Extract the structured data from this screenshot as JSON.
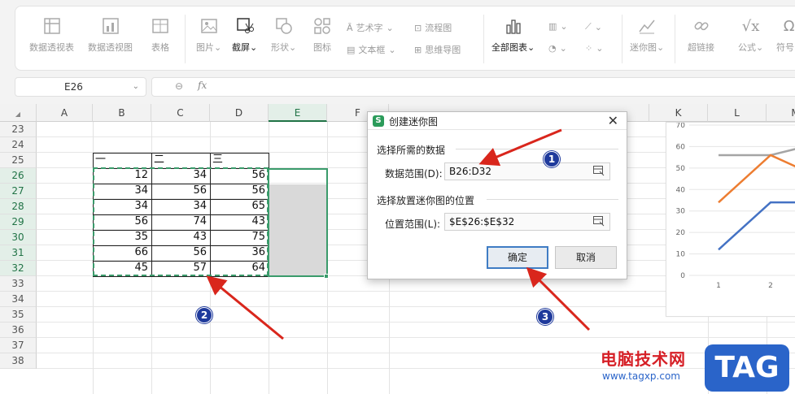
{
  "ribbon": {
    "pivot_table": "数据透视表",
    "pivot_chart": "数据透视图",
    "table": "表格",
    "picture": "图片",
    "screenshot": "截屏",
    "shape": "形状",
    "icon": "图标",
    "wordart": "艺术字",
    "flowchart": "流程图",
    "textbox": "文本框",
    "mindmap": "思维导图",
    "all_charts": "全部图表",
    "sparkline": "迷你图",
    "hyperlink": "超链接",
    "formula": "公式",
    "symbol": "符号"
  },
  "formula_bar": {
    "name_box": "E26",
    "fx_label": "fx"
  },
  "sheet": {
    "columns": [
      "A",
      "B",
      "C",
      "D",
      "E",
      "F",
      "K",
      "L",
      "M"
    ],
    "selected_column": "E",
    "rows": [
      "23",
      "24",
      "25",
      "26",
      "27",
      "28",
      "29",
      "30",
      "31",
      "32",
      "33",
      "34",
      "35",
      "36",
      "37",
      "38"
    ],
    "headers": [
      "一",
      "二",
      "三"
    ],
    "data": [
      [
        12,
        34,
        56
      ],
      [
        34,
        56,
        56
      ],
      [
        34,
        34,
        65
      ],
      [
        56,
        74,
        43
      ],
      [
        35,
        43,
        75
      ],
      [
        66,
        56,
        36
      ],
      [
        45,
        57,
        64
      ]
    ]
  },
  "chart_data": {
    "type": "line",
    "y_ticks": [
      "70",
      "60",
      "50",
      "40",
      "30",
      "20",
      "10",
      "0"
    ],
    "x_ticks": [
      "1",
      "2"
    ],
    "ylim": [
      0,
      70
    ],
    "series": [
      {
        "color": "#a5a5a5",
        "values": [
          56,
          56,
          62
        ]
      },
      {
        "color": "#ed7d31",
        "values": [
          34,
          56,
          45
        ]
      },
      {
        "color": "#4472c4",
        "values": [
          12,
          34,
          34
        ]
      }
    ]
  },
  "dialog": {
    "title": "创建迷你图",
    "section1": "选择所需的数据",
    "data_range_label": "数据范围(D):",
    "data_range_value": "B26:D32",
    "section2": "选择放置迷你图的位置",
    "location_label": "位置范围(L):",
    "location_value": "$E$26:$E$32",
    "ok": "确定",
    "cancel": "取消"
  },
  "callouts": [
    "1",
    "2",
    "3"
  ],
  "colors": {
    "accent": "#217346",
    "arrow": "#d9261c",
    "callout": "#1f3a9c"
  },
  "watermark": {
    "site_cn": "电脑技术网",
    "url": "www.tagxp.com",
    "tag": "TAG"
  }
}
